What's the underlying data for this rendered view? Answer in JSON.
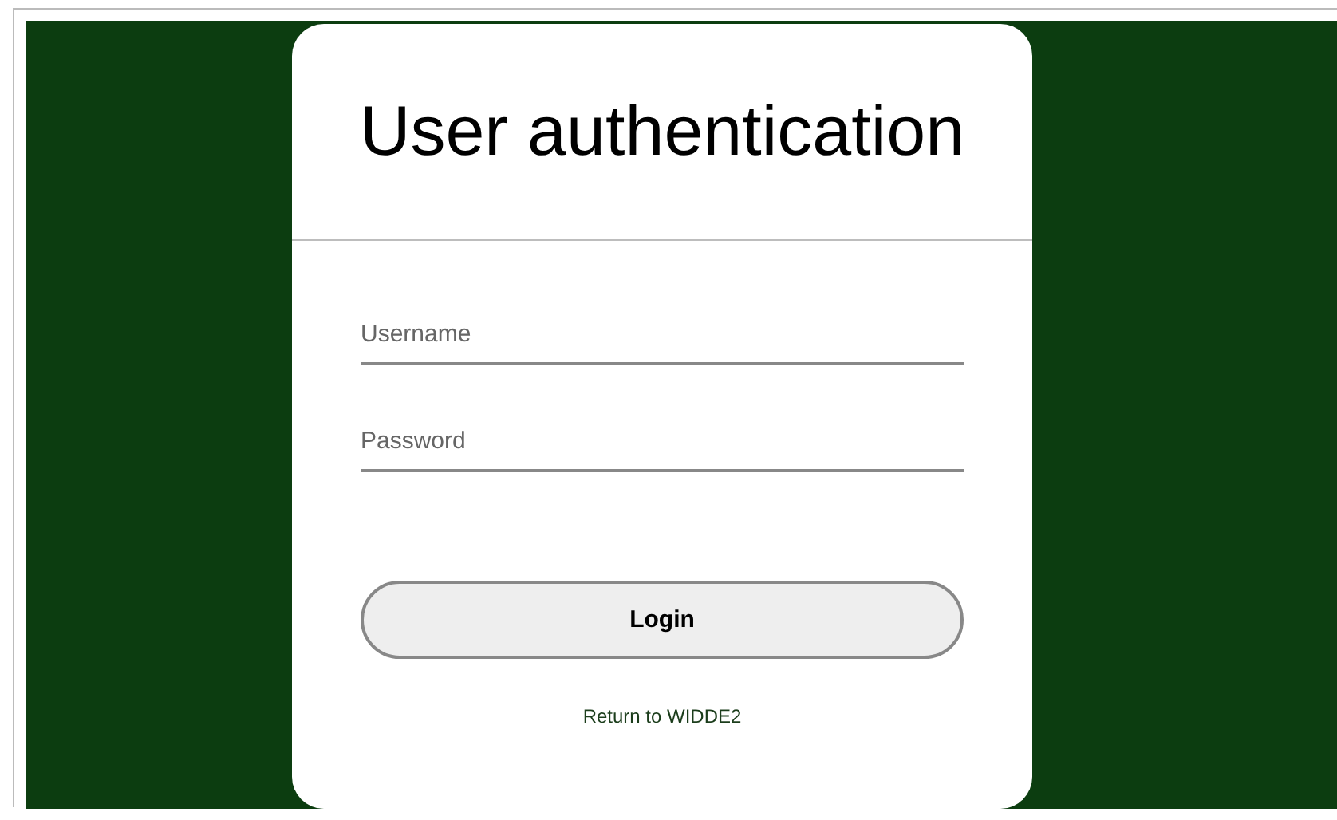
{
  "title": "User authentication",
  "fields": [
    {
      "placeholder": "Username"
    },
    {
      "placeholder": "Password"
    }
  ],
  "login_button": "Login",
  "return_link": "Return to WIDDE2"
}
